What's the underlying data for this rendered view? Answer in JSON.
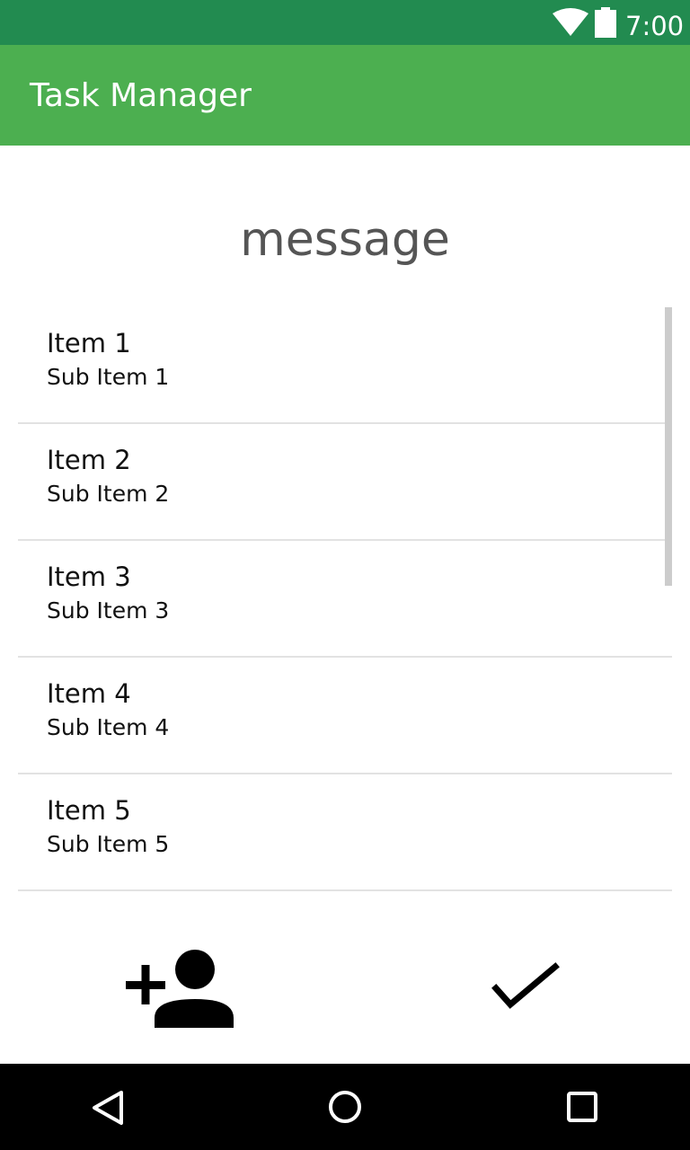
{
  "status_bar": {
    "time": "7:00",
    "icons": [
      "wifi-icon",
      "battery-icon"
    ],
    "color": "#228B50"
  },
  "app_bar": {
    "title": "Task Manager",
    "color": "#4CAF50"
  },
  "message": "message",
  "list": {
    "items": [
      {
        "title": "Item 1",
        "subtitle": "Sub Item 1"
      },
      {
        "title": "Item 2",
        "subtitle": "Sub Item 2"
      },
      {
        "title": "Item 3",
        "subtitle": "Sub Item 3"
      },
      {
        "title": "Item 4",
        "subtitle": "Sub Item 4"
      },
      {
        "title": "Item 5",
        "subtitle": "Sub Item 5"
      }
    ]
  },
  "actions": {
    "left_icon": "add-person-icon",
    "right_icon": "check-icon"
  },
  "nav_bar": {
    "icons": [
      "back-icon",
      "home-icon",
      "recent-apps-icon"
    ]
  }
}
